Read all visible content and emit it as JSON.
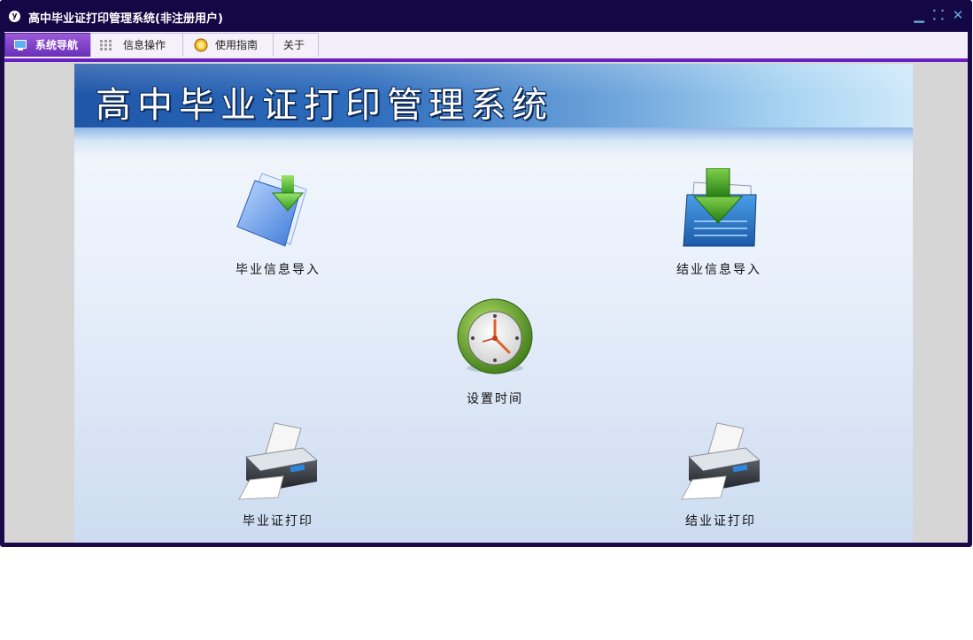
{
  "window": {
    "title": "高中毕业证打印管理系统(非注册用户)",
    "app_icon_letter": "y",
    "controls": {
      "minimize": "▁",
      "restore": "⸬",
      "close": "✕"
    }
  },
  "menu": {
    "items": [
      {
        "label": "系统导航",
        "icon": "monitor-icon",
        "active": true
      },
      {
        "label": "信息操作",
        "icon": "grid-icon",
        "active": false
      },
      {
        "label": "使用指南",
        "icon": "help-icon",
        "active": false
      },
      {
        "label": "关于",
        "icon": "",
        "active": false
      }
    ]
  },
  "banner": {
    "title": "高中毕业证打印管理系统"
  },
  "nav": {
    "graduation_import": {
      "label": "毕业信息导入",
      "icon": "document-import-icon"
    },
    "completion_import": {
      "label": "结业信息导入",
      "icon": "folder-import-icon"
    },
    "set_time": {
      "label": "设置时间",
      "icon": "clock-icon"
    },
    "graduation_print": {
      "label": "毕业证打印",
      "icon": "printer-icon"
    },
    "completion_print": {
      "label": "结业证打印",
      "icon": "printer-icon"
    }
  },
  "colors": {
    "title_bg": "#140745",
    "menu_accent": "#6a1fc0",
    "banner_dark": "#1f56a8",
    "banner_light": "#cfe9fa"
  }
}
